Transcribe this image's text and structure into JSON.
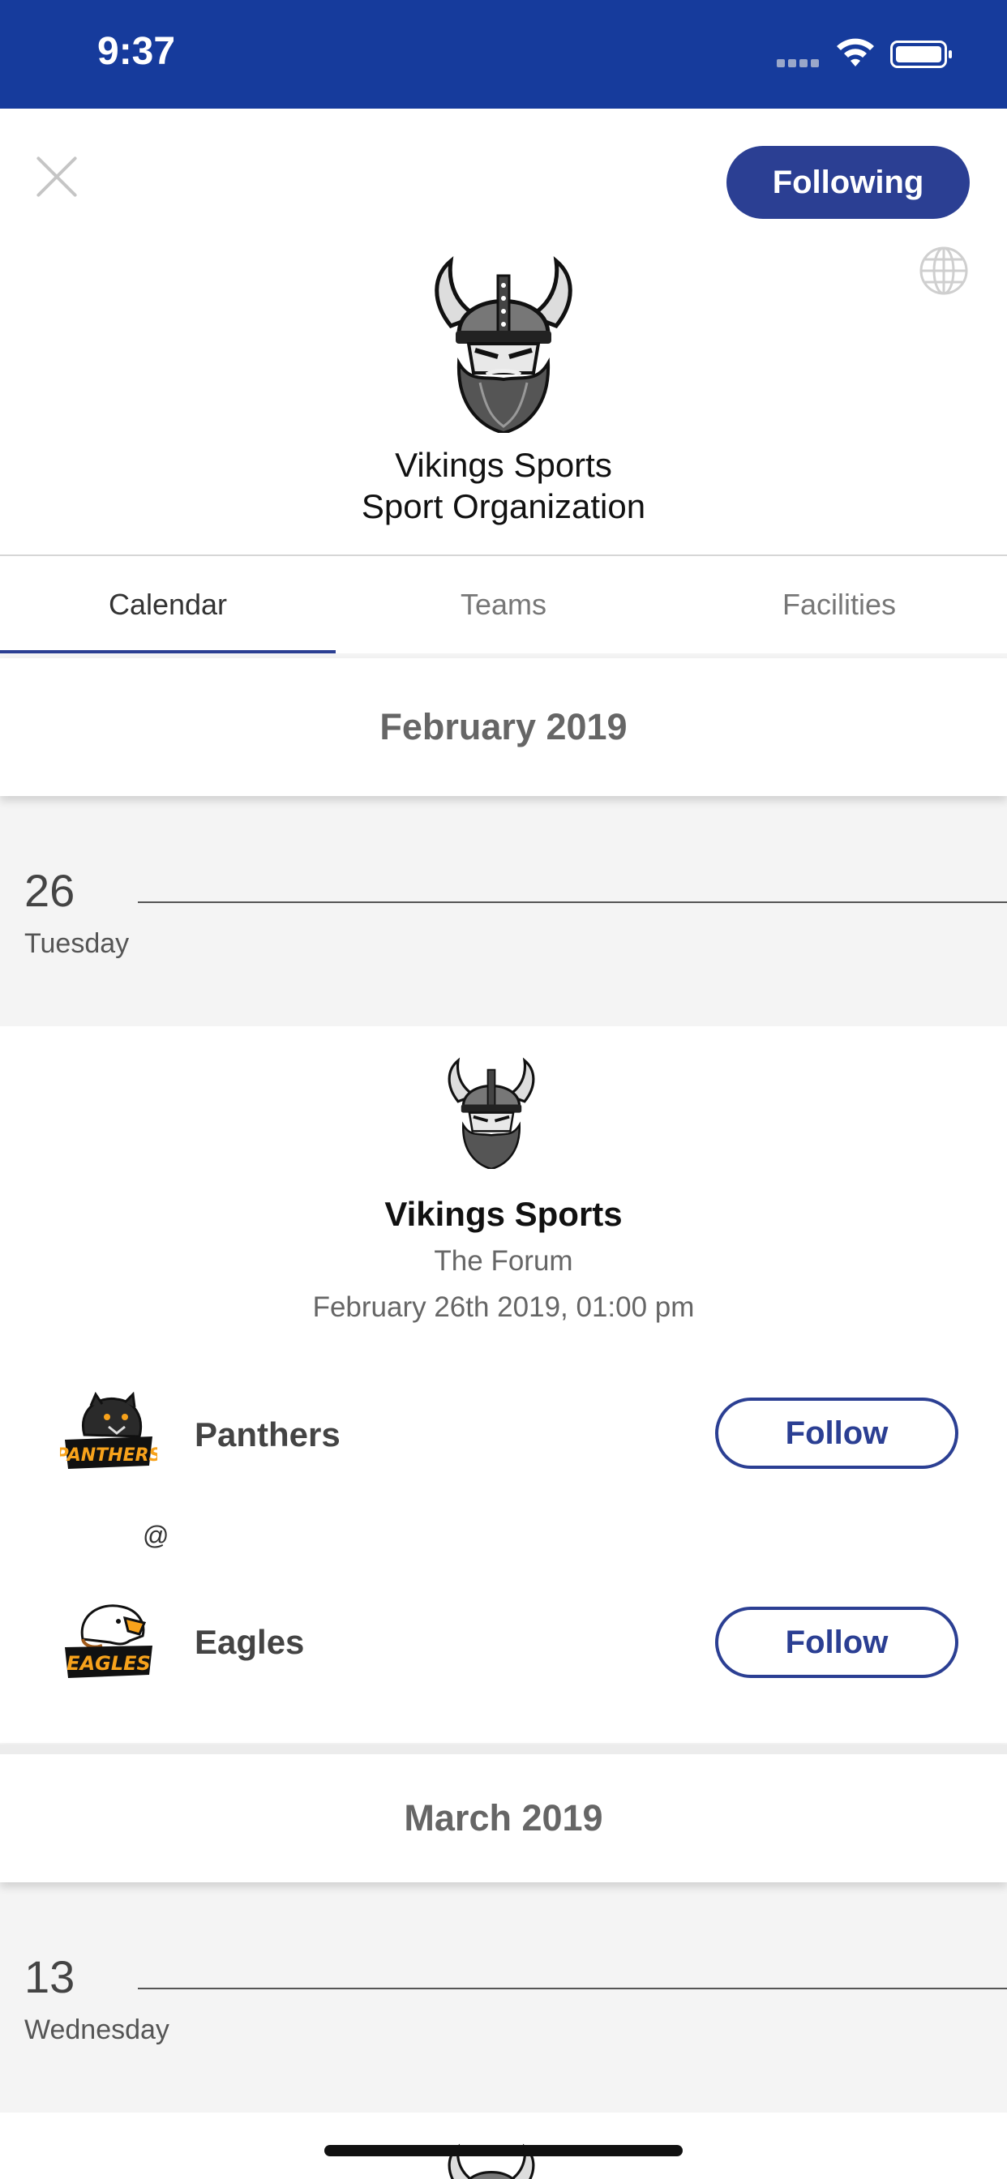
{
  "status_bar": {
    "time": "9:37"
  },
  "header": {
    "follow_state_label": "Following",
    "org_name": "Vikings Sports",
    "org_type": "Sport Organization"
  },
  "tabs": [
    {
      "label": "Calendar",
      "active": true
    },
    {
      "label": "Teams",
      "active": false
    },
    {
      "label": "Facilities",
      "active": false
    }
  ],
  "calendar": {
    "months": [
      {
        "label": "February 2019",
        "days": [
          {
            "day_number": "26",
            "weekday": "Tuesday",
            "events": [
              {
                "host": "Vikings Sports",
                "venue": "The Forum",
                "datetime": "February 26th 2019, 01:00 pm",
                "home_team": {
                  "name": "Panthers",
                  "follow_label": "Follow"
                },
                "separator": "@",
                "away_team": {
                  "name": "Eagles",
                  "follow_label": "Follow"
                }
              }
            ]
          }
        ]
      },
      {
        "label": "March 2019",
        "days": [
          {
            "day_number": "13",
            "weekday": "Wednesday"
          }
        ]
      }
    ]
  },
  "colors": {
    "status_bar": "#163b9c",
    "accent": "#2b3f93",
    "page_background": "#f4f4f4"
  },
  "icons": [
    "close-icon",
    "globe-icon",
    "wifi-icon",
    "battery-icon",
    "signal-icon"
  ]
}
